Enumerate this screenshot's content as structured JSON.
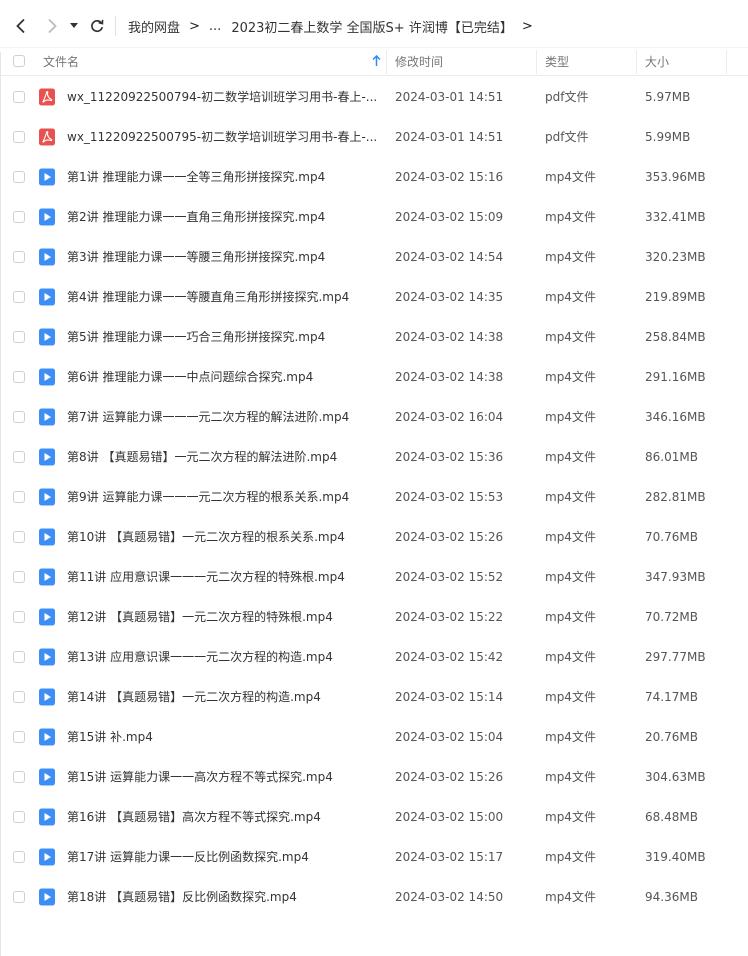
{
  "breadcrumb": {
    "items": [
      "我的网盘",
      "...",
      "2023初二春上数学 全国版S+ 许润博【已完结】"
    ],
    "separator": ">"
  },
  "columns": {
    "name": "文件名",
    "modified": "修改时间",
    "type": "类型",
    "size": "大小"
  },
  "files": [
    {
      "icon": "pdf",
      "name": "wx_11220922500794-初二数学培训班学习用书-春上-...",
      "modified": "2024-03-01 14:51",
      "type": "pdf文件",
      "size": "5.97MB"
    },
    {
      "icon": "pdf",
      "name": "wx_11220922500795-初二数学培训班学习用书-春上-...",
      "modified": "2024-03-01 14:51",
      "type": "pdf文件",
      "size": "5.99MB"
    },
    {
      "icon": "video",
      "name": "第1讲 推理能力课一一全等三角形拼接探究.mp4",
      "modified": "2024-03-02 15:16",
      "type": "mp4文件",
      "size": "353.96MB"
    },
    {
      "icon": "video",
      "name": "第2讲 推理能力课一一直角三角形拼接探究.mp4",
      "modified": "2024-03-02 15:09",
      "type": "mp4文件",
      "size": "332.41MB"
    },
    {
      "icon": "video",
      "name": "第3讲 推理能力课一一等腰三角形拼接探究.mp4",
      "modified": "2024-03-02 14:54",
      "type": "mp4文件",
      "size": "320.23MB"
    },
    {
      "icon": "video",
      "name": "第4讲 推理能力课一一等腰直角三角形拼接探究.mp4",
      "modified": "2024-03-02 14:35",
      "type": "mp4文件",
      "size": "219.89MB"
    },
    {
      "icon": "video",
      "name": "第5讲 推理能力课一一巧合三角形拼接探究.mp4",
      "modified": "2024-03-02 14:38",
      "type": "mp4文件",
      "size": "258.84MB"
    },
    {
      "icon": "video",
      "name": "第6讲 推理能力课一一中点问题综合探究.mp4",
      "modified": "2024-03-02 14:38",
      "type": "mp4文件",
      "size": "291.16MB"
    },
    {
      "icon": "video",
      "name": "第7讲 运算能力课一一一元二次方程的解法进阶.mp4",
      "modified": "2024-03-02 16:04",
      "type": "mp4文件",
      "size": "346.16MB"
    },
    {
      "icon": "video",
      "name": "第8讲 【真题易错】一元二次方程的解法进阶.mp4",
      "modified": "2024-03-02 15:36",
      "type": "mp4文件",
      "size": "86.01MB"
    },
    {
      "icon": "video",
      "name": "第9讲 运算能力课一一一元二次方程的根系关系.mp4",
      "modified": "2024-03-02 15:53",
      "type": "mp4文件",
      "size": "282.81MB"
    },
    {
      "icon": "video",
      "name": "第10讲 【真题易错】一元二次方程的根系关系.mp4",
      "modified": "2024-03-02 15:26",
      "type": "mp4文件",
      "size": "70.76MB"
    },
    {
      "icon": "video",
      "name": "第11讲 应用意识课一一一元二次方程的特殊根.mp4",
      "modified": "2024-03-02 15:52",
      "type": "mp4文件",
      "size": "347.93MB"
    },
    {
      "icon": "video",
      "name": "第12讲 【真题易错】一元二次方程的特殊根.mp4",
      "modified": "2024-03-02 15:22",
      "type": "mp4文件",
      "size": "70.72MB"
    },
    {
      "icon": "video",
      "name": "第13讲 应用意识课一一一元二次方程的构造.mp4",
      "modified": "2024-03-02 15:42",
      "type": "mp4文件",
      "size": "297.77MB"
    },
    {
      "icon": "video",
      "name": "第14讲 【真题易错】一元二次方程的构造.mp4",
      "modified": "2024-03-02 15:14",
      "type": "mp4文件",
      "size": "74.17MB"
    },
    {
      "icon": "video",
      "name": "第15讲 补.mp4",
      "modified": "2024-03-02 15:04",
      "type": "mp4文件",
      "size": "20.76MB"
    },
    {
      "icon": "video",
      "name": "第15讲 运算能力课一一高次方程不等式探究.mp4",
      "modified": "2024-03-02 15:26",
      "type": "mp4文件",
      "size": "304.63MB"
    },
    {
      "icon": "video",
      "name": "第16讲 【真题易错】高次方程不等式探究.mp4",
      "modified": "2024-03-02 15:00",
      "type": "mp4文件",
      "size": "68.48MB"
    },
    {
      "icon": "video",
      "name": "第17讲 运算能力课一一反比例函数探究.mp4",
      "modified": "2024-03-02 15:17",
      "type": "mp4文件",
      "size": "319.40MB"
    },
    {
      "icon": "video",
      "name": "第18讲 【真题易错】反比例函数探究.mp4",
      "modified": "2024-03-02 14:50",
      "type": "mp4文件",
      "size": "94.36MB"
    }
  ],
  "colors": {
    "pdf_icon": "#e8514f",
    "video_icon": "#3d8ff5",
    "sort_arrow": "#2f8cf6"
  }
}
